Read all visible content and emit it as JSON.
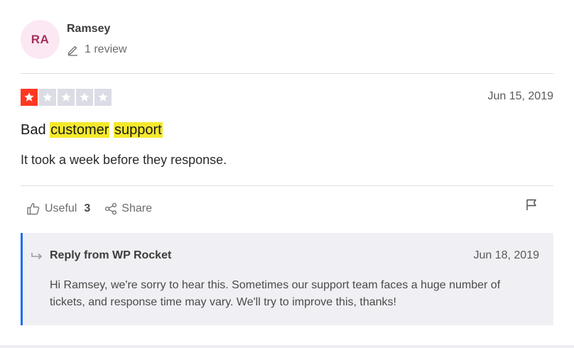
{
  "reviewer": {
    "initials": "RA",
    "name": "Ramsey",
    "review_count": "1 review"
  },
  "review": {
    "rating": 1,
    "max_rating": 5,
    "date": "Jun 15, 2019",
    "title_prefix": "Bad",
    "title_highlight_1": "customer",
    "title_highlight_2": "support",
    "body": "It took a week before they response."
  },
  "actions": {
    "useful_label": "Useful",
    "useful_count": "3",
    "share_label": "Share"
  },
  "reply": {
    "from": "Reply from WP Rocket",
    "date": "Jun 18, 2019",
    "text": "Hi Ramsey, we're sorry to hear this. Sometimes our support team faces a huge number of tickets, and response time may vary. We'll try to improve this, thanks!"
  },
  "colors": {
    "star_filled": "#ff3722",
    "star_empty": "#dcdce6",
    "highlight": "#f5e92d",
    "reply_accent": "#1c6ef2",
    "avatar_bg": "#fce8f3",
    "avatar_text": "#a2305f"
  },
  "icons": {
    "review_count": "pencil-icon",
    "useful": "thumbs-up-icon",
    "share": "share-icon",
    "flag": "flag-icon",
    "reply": "reply-arrow-icon",
    "star": "star-icon"
  }
}
